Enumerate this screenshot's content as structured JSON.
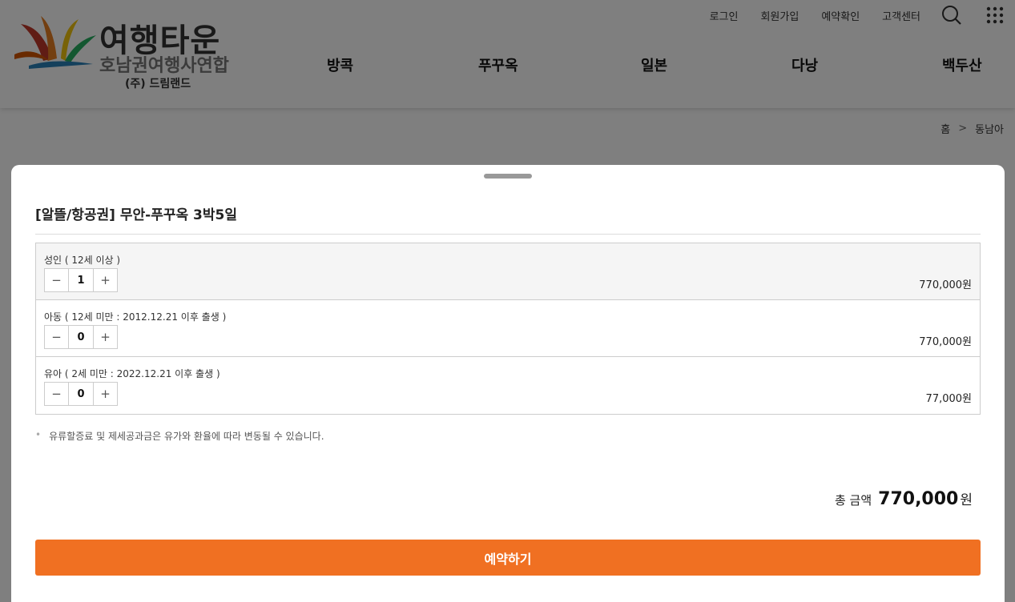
{
  "header": {
    "logo_title": "여행타운",
    "logo_subtitle": "호남권여행사연합",
    "logo_company": "(주) 드림랜드",
    "util_nav": [
      "로그인",
      "회원가입",
      "예약확인",
      "고객센터"
    ],
    "main_nav": [
      "방콕",
      "푸꾸옥",
      "일본",
      "다낭",
      "백두산"
    ]
  },
  "breadcrumb": {
    "home": "홈",
    "current": "동남아"
  },
  "sheet": {
    "product_title": "[알뜰/항공권] 무안-푸꾸옥 3박5일",
    "options": [
      {
        "label": "성인 ( 12세 이상 )",
        "quantity": "1",
        "price": "770,000원"
      },
      {
        "label": "아동 ( 12세 미만 : 2012.12.21 이후 출생 )",
        "quantity": "0",
        "price": "770,000원"
      },
      {
        "label": "유아 ( 2세 미만 : 2022.12.21 이후 출생 )",
        "quantity": "0",
        "price": "77,000원"
      }
    ],
    "stepper": {
      "minus": "−",
      "plus": "+"
    },
    "notice": "유류할증료 및 제세공과금은 유가와 환율에 따라 변동될 수 있습니다.",
    "total_label": "총 금액",
    "total_amount": "770,000",
    "total_unit": "원",
    "reserve_label": "예약하기"
  },
  "colors": {
    "accent": "#f07022",
    "overlay": "rgba(0,0,0,0.5)"
  }
}
